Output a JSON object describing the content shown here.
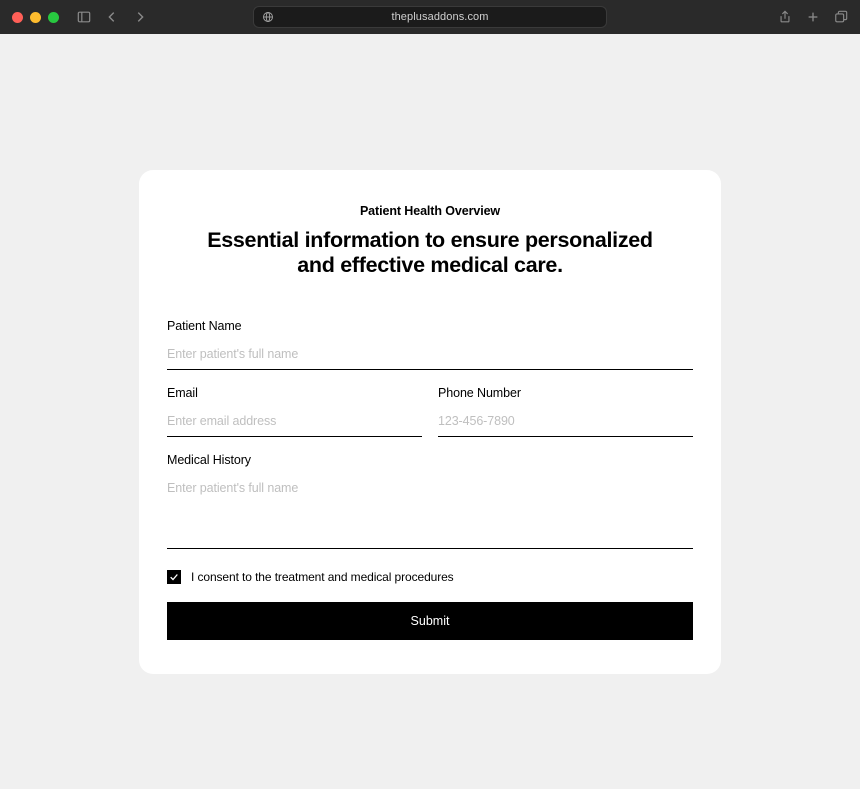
{
  "browser": {
    "url": "theplusaddons.com"
  },
  "card": {
    "overline": "Patient Health Overview",
    "headline": "Essential information to ensure personalized and effective medical care."
  },
  "form": {
    "patient_name": {
      "label": "Patient Name",
      "placeholder": "Enter patient's full name",
      "value": ""
    },
    "email": {
      "label": "Email",
      "placeholder": "Enter email address",
      "value": ""
    },
    "phone": {
      "label": "Phone Number",
      "placeholder": "123-456-7890",
      "value": ""
    },
    "medical_history": {
      "label": "Medical History",
      "placeholder": "Enter patient's full name",
      "value": ""
    },
    "consent": {
      "label": "I consent to the treatment and medical procedures",
      "checked": true
    },
    "submit_label": "Submit"
  }
}
